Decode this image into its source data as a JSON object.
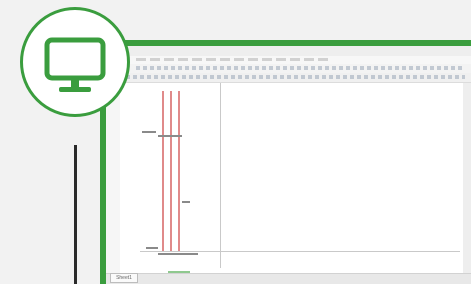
{
  "app": {
    "screen": {
      "sheet_tab_label": "Sheet1"
    },
    "badge": {
      "icon": "monitor-icon"
    },
    "colors": {
      "accent": "#3a9d3e",
      "wire": "#e08a8a",
      "connector": "#2a2a2a"
    }
  }
}
